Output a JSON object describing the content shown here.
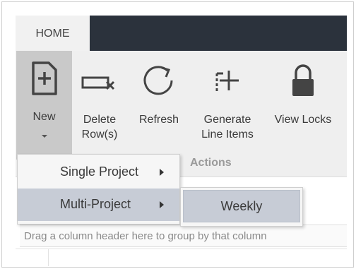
{
  "ribbon": {
    "active_tab": "HOME",
    "buttons": {
      "new": "New",
      "delete_line1": "Delete",
      "delete_line2": "Row(s)",
      "refresh": "Refresh",
      "generate_line1": "Generate",
      "generate_line2": "Line Items",
      "view_locks": "View Locks"
    },
    "group_label": "Actions",
    "icons": {
      "new": "new-document-icon",
      "delete": "delete-row-icon",
      "refresh": "refresh-icon",
      "generate": "generate-line-items-icon",
      "view_locks": "lock-icon"
    }
  },
  "new_menu": {
    "items": [
      {
        "label": "Single Project",
        "has_submenu": true
      },
      {
        "label": "Multi-Project",
        "has_submenu": true,
        "highlighted": true
      }
    ],
    "submenu": {
      "items": [
        {
          "label": "Weekly",
          "highlighted": true
        }
      ]
    }
  },
  "grid": {
    "group_panel_text": "Drag a column header here to group by that column"
  },
  "colors": {
    "ribbon_dark": "#2b323c",
    "ribbon_body": "#efefef",
    "highlight": "#c7ccd6",
    "pressed_button": "#c9c9c9"
  }
}
